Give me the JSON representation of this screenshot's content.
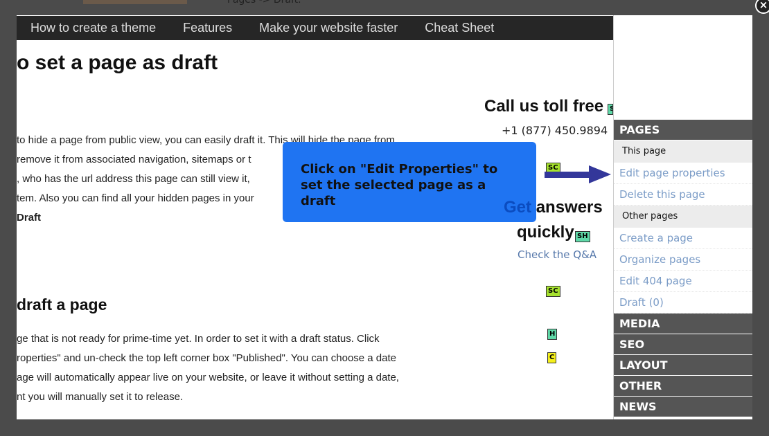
{
  "background": {
    "text": "Pages -> Draft."
  },
  "nav": [
    "How to create a theme",
    "Features",
    "Make your website faster",
    "Cheat Sheet"
  ],
  "article": {
    "title": "o set a page as draft",
    "para1": [
      "to hide a page from public view, you can easily draft it. This will hide the page from",
      "remove it from associated navigation, sitemaps or t",
      ", who has the url address this page can still view it,",
      "tem. Also you can find all your hidden pages in your"
    ],
    "para1_bold": "Draft",
    "heading2": "draft a page",
    "para2": [
      "ge that is not ready for prime-time yet. In order to set it with a draft status. Click",
      "roperties\" and un-check the top left corner box \"Published\". You can choose a date",
      "age will automatically appear live on your website, or leave it without setting a date,",
      "nt you will manually set it to release."
    ]
  },
  "contact": {
    "call": "Call us toll free",
    "phone": "+1 (877) 450.9894",
    "get": "Get",
    "answers": "answers",
    "quickly": "quickly",
    "qa": "Check the Q&A"
  },
  "tags": [
    "SC",
    "SH",
    "SC",
    "H",
    "C",
    "S"
  ],
  "tooltip": {
    "text": "Click on \"Edit Properties\" to set the selected page as a draft",
    "color": "#1f74f2"
  },
  "sidebar": {
    "pages": "PAGES",
    "this_page": "This page",
    "this_items": [
      "Edit page properties",
      "Delete this page"
    ],
    "other_pages": "Other pages",
    "other_items": [
      "Create a page",
      "Organize pages",
      "Edit 404 page",
      "Draft (0)"
    ],
    "sections": [
      "MEDIA",
      "SEO",
      "LAYOUT",
      "OTHER",
      "NEWS"
    ]
  },
  "close_label": "×"
}
